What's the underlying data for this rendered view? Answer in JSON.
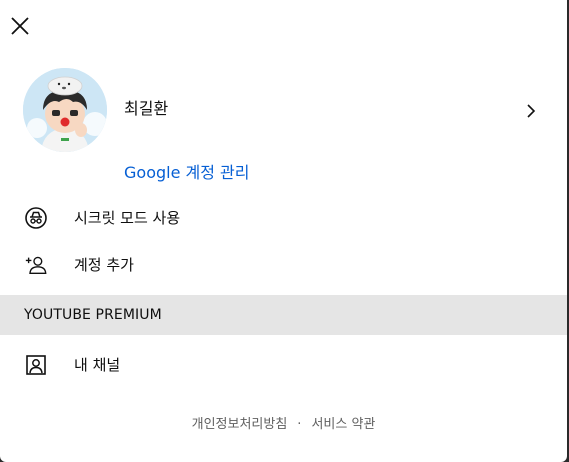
{
  "header": {
    "close_icon": "close-icon"
  },
  "account": {
    "avatar_icon": "avatar",
    "name": "최길환",
    "chevron_icon": "chevron-right-icon",
    "manage_label": "Google 계정 관리"
  },
  "menu": [
    {
      "icon": "incognito-icon",
      "label": "시크릿 모드 사용"
    },
    {
      "icon": "add-account-icon",
      "label": "계정 추가"
    }
  ],
  "premium": {
    "label": "YOUTUBE PREMIUM"
  },
  "channel": {
    "icon": "channel-icon",
    "label": "내 채널"
  },
  "footer": {
    "privacy_label": "개인정보처리방침",
    "separator": "·",
    "terms_label": "서비스 약관"
  }
}
